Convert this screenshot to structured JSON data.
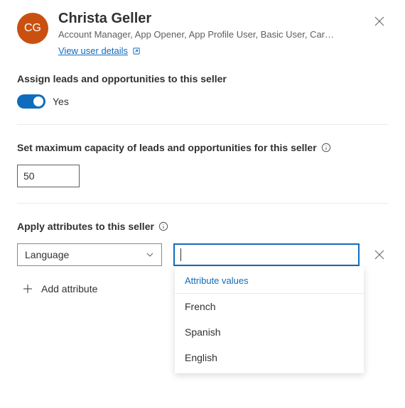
{
  "user": {
    "initials": "CG",
    "name": "Christa Geller",
    "roles": "Account Manager, App Opener, App Profile User, Basic User, Car…",
    "view_details": "View user details"
  },
  "assign": {
    "label": "Assign leads and opportunities to this seller",
    "toggle_value": "Yes"
  },
  "capacity": {
    "label": "Set maximum capacity of leads and opportunities for this seller",
    "value": "50"
  },
  "attributes": {
    "label": "Apply attributes to this seller",
    "selected_key": "Language",
    "dropdown_header": "Attribute values",
    "options": [
      "French",
      "Spanish",
      "English"
    ],
    "add_label": "Add attribute"
  }
}
